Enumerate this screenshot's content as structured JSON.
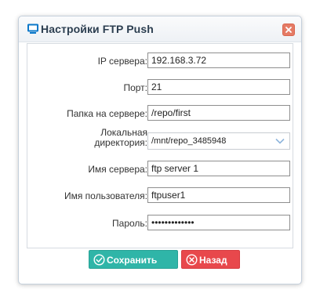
{
  "dialog": {
    "title": "Настройки FTP Push",
    "icon": "monitor-icon",
    "close_icon": "close-icon",
    "accent_color": "#0b78c9"
  },
  "form": {
    "ip_label": "IP сервера:",
    "ip_value": "192.168.3.72",
    "port_label": "Порт:",
    "port_value": "21",
    "folder_label": "Папка на сервере:",
    "folder_value": "/repo/first",
    "local_dir_label_line1": "Локальная",
    "local_dir_label_line2": "директория:",
    "local_dir_value": "/mnt/repo_3485948",
    "server_name_label": "Имя сервера:",
    "server_name_value": "ftp server 1",
    "username_label": "Имя пользователя:",
    "username_value": "ftpuser1",
    "password_label": "Пароль:",
    "password_value": "•••••••••••••"
  },
  "buttons": {
    "save_label": "Сохранить",
    "save_icon": "check-circle-icon",
    "save_color": "#2fb5a8",
    "back_label": "Назад",
    "back_icon": "x-circle-icon",
    "back_color": "#e8484c"
  }
}
